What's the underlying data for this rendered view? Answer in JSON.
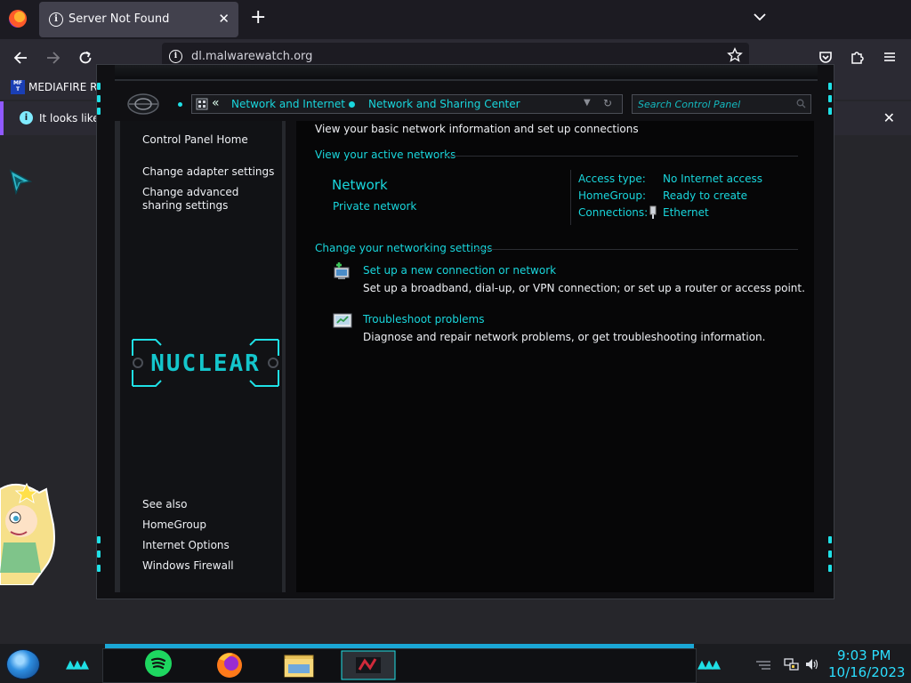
{
  "browser": {
    "tab": {
      "title": "Server Not Found",
      "close": "✕"
    },
    "new_tab": "+",
    "url": "dl.malwarewatch.org",
    "bookmark": {
      "icon_text": "MF T",
      "label": "MEDIAFIRE RO"
    },
    "notification": {
      "text": "It looks like y"
    }
  },
  "control_panel": {
    "breadcrumb": [
      "Network and Internet",
      "Network and Sharing Center"
    ],
    "search_placeholder": "Search Control Panel",
    "left_pane": {
      "home": "Control Panel Home",
      "links": [
        "Change adapter settings",
        "Change advanced sharing settings"
      ],
      "see_also_title": "See also",
      "see_also": [
        "HomeGroup",
        "Internet Options",
        "Windows Firewall"
      ],
      "logo": "NUCLEAR"
    },
    "main": {
      "heading": "View your basic network information and set up connections",
      "active_networks_title": "View your active networks",
      "network": {
        "name": "Network",
        "type": "Private network"
      },
      "info": {
        "access_type_label": "Access type:",
        "access_type_value": "No Internet access",
        "homegroup_label": "HomeGroup:",
        "homegroup_value": "Ready to create",
        "connections_label": "Connections:",
        "connections_value": "Ethernet"
      },
      "settings_title": "Change your networking settings",
      "tasks": [
        {
          "title": "Set up a new connection or network",
          "desc": "Set up a broadband, dial-up, or VPN connection; or set up a router or access point.",
          "icon": "network-setup-icon"
        },
        {
          "title": "Troubleshoot problems",
          "desc": "Diagnose and repair network problems, or get troubleshooting information.",
          "icon": "troubleshoot-icon"
        }
      ]
    }
  },
  "taskbar": {
    "time": "9:03 PM",
    "date": "10/16/2023",
    "apps": [
      "spotify",
      "firefox",
      "file-explorer",
      "network-sharing-center"
    ]
  },
  "colors": {
    "accent_cyan": "#19d6dc",
    "firefox_purple": "#9059ff",
    "clock_blue": "#2bdfff"
  }
}
